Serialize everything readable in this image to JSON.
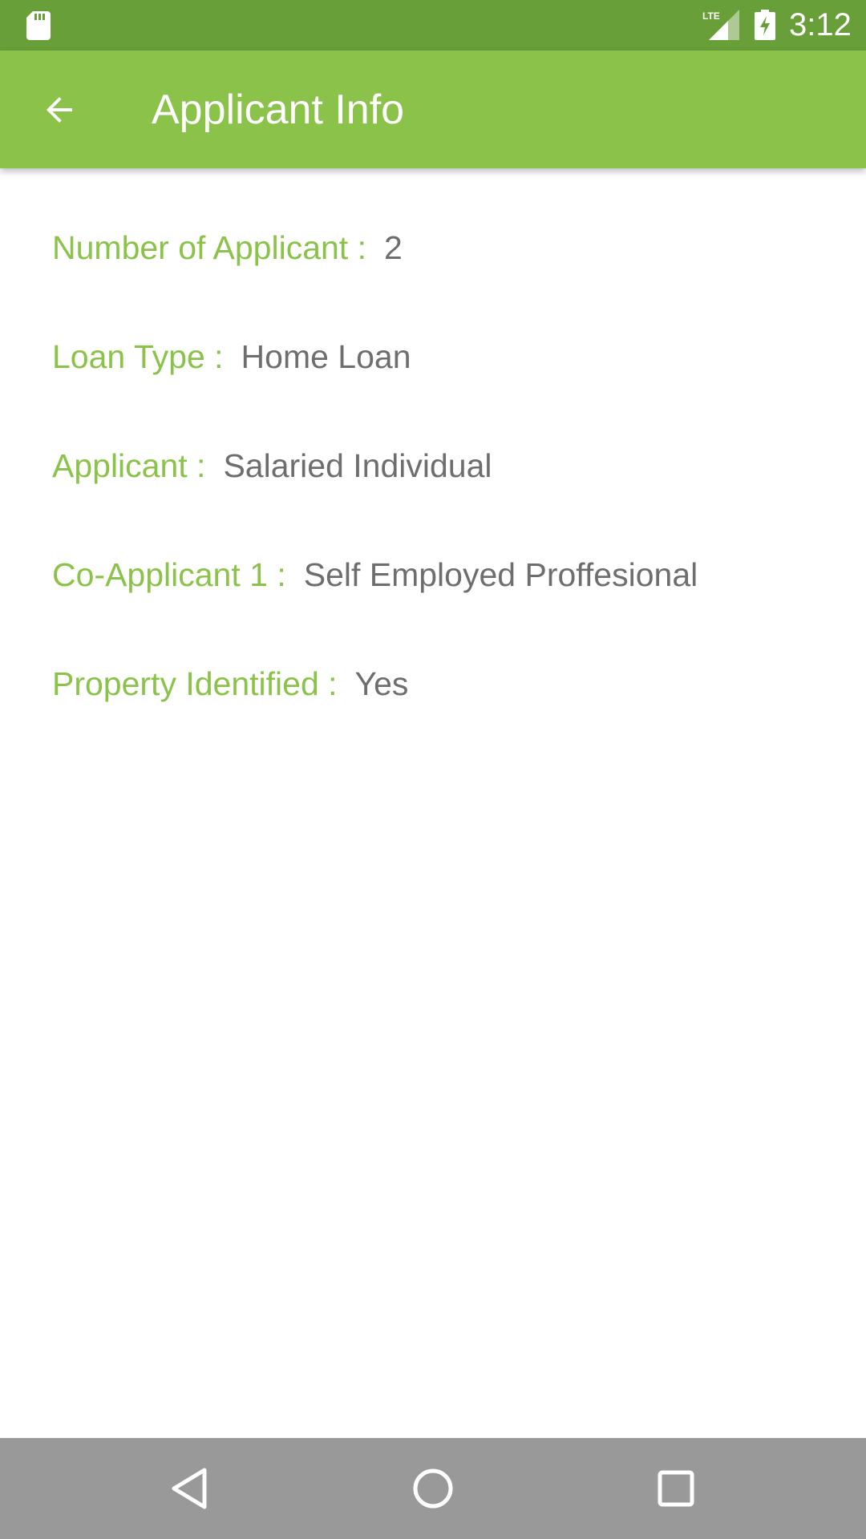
{
  "status_bar": {
    "time": "3:12",
    "network_label": "LTE",
    "icons": [
      "sd-card-icon",
      "lte-signal-icon",
      "battery-charging-icon"
    ]
  },
  "app_bar": {
    "title": "Applicant Info",
    "back_icon": "arrow-back-icon"
  },
  "details": [
    {
      "label": "Number of Applicant :",
      "value": "2"
    },
    {
      "label": "Loan Type :",
      "value": "Home Loan"
    },
    {
      "label": "Applicant :",
      "value": "Salaried Individual"
    },
    {
      "label": "Co-Applicant 1 :",
      "value": "Self Employed Proffesional"
    },
    {
      "label": "Property Identified :",
      "value": "Yes"
    }
  ],
  "nav_bar": {
    "icons": [
      "nav-back-icon",
      "nav-home-icon",
      "nav-recents-icon"
    ]
  },
  "colors": {
    "status_bar": "#689f38",
    "app_bar": "#8bc34a",
    "label": "#8bc34a",
    "value": "#6e6e6e",
    "nav_bar": "#999999"
  }
}
